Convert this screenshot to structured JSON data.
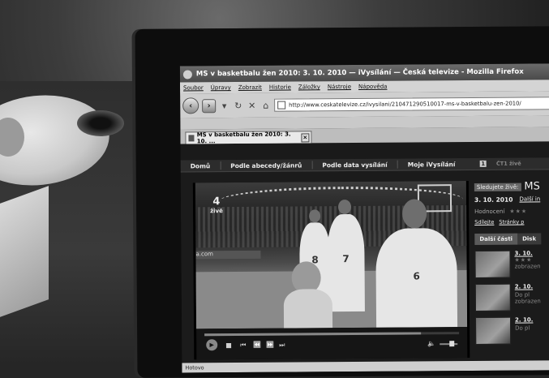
{
  "window": {
    "title": "MS v basketbalu žen 2010: 3. 10. 2010 — iVysílání — Česká televize - Mozilla Firefox"
  },
  "menu": [
    "Soubor",
    "Úpravy",
    "Zobrazit",
    "Historie",
    "Záložky",
    "Nástroje",
    "Nápověda"
  ],
  "navbar": {
    "back_icon": "back-arrow-icon",
    "forward_icon": "forward-arrow-icon",
    "url": "http://www.ceskatelevize.cz/ivysilani/210471290510017-ms-v-basketbalu-zen-2010/"
  },
  "tab": {
    "label": "MS v basketbalu žen 2010: 3. 10. ...",
    "close": "×"
  },
  "site": {
    "nav": [
      "Domů",
      "Podle abecedy/žánrů",
      "Podle data vysílání",
      "Moje iVysílání"
    ],
    "channel_badge": "1",
    "channel_label": "ČT1 živě"
  },
  "video": {
    "channel_logo_number": "4",
    "channel_logo_text": "živě",
    "jersey_numbers": [
      "8",
      "7",
      "6"
    ],
    "adboard_text": "a.com",
    "progress_fraction": 0.85
  },
  "side": {
    "watching_label": "Sledujete živě:",
    "watching_title": "MS",
    "date": "3. 10. 2010",
    "more_link": "Další in",
    "rating_label": "Hodnocení",
    "share_label": "Sdílejte",
    "pages_label": "Stránky p",
    "tabs": [
      "Další části",
      "Disk"
    ],
    "episodes": [
      {
        "title": "3. 10.",
        "line2": "zobrazen"
      },
      {
        "title": "2. 10.",
        "line2": "Do pl",
        "line3": "zobrazen"
      },
      {
        "title": "2. 10.",
        "line2": "Do pl"
      }
    ]
  },
  "status": {
    "text": "Hotovo"
  }
}
